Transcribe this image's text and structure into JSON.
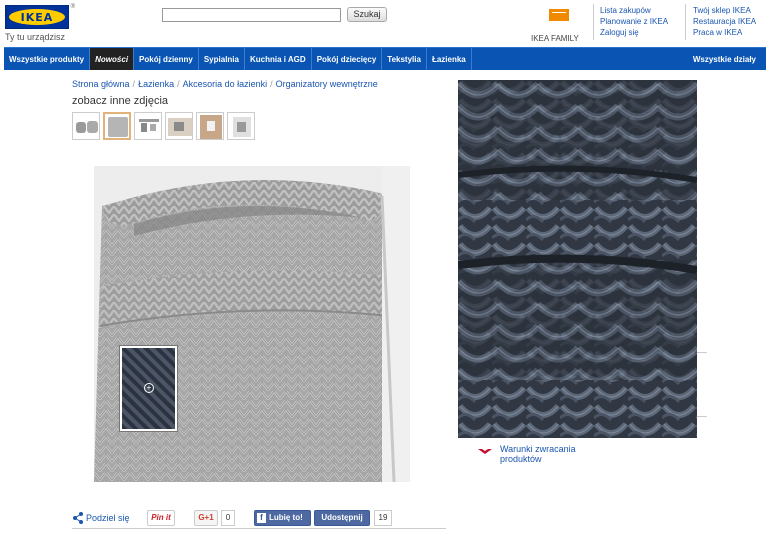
{
  "header": {
    "logo_text": "IKEA",
    "tagline": "Ty tu urządzisz",
    "search": {
      "value": "",
      "button_label": "Szukaj"
    },
    "family_label": "IKEA FAMILY",
    "links_col1": [
      "Lista zakupów",
      "Planowanie z IKEA",
      "Zaloguj się"
    ],
    "links_col2": [
      "Twój sklep IKEA",
      "Restauracja IKEA",
      "Praca w IKEA"
    ]
  },
  "nav": {
    "items": [
      "Wszystkie produkty",
      "Nowości",
      "Pokój dzienny",
      "Sypialnia",
      "Kuchnia i AGD",
      "Pokój dziecięcy",
      "Tekstylia",
      "Łazienka"
    ],
    "active": "Nowości",
    "all_departments": "Wszystkie działy"
  },
  "breadcrumb": [
    "Strona główna",
    "Łazienka",
    "Akcesoria do łazienki",
    "Organizatory wewnętrzne"
  ],
  "gallery": {
    "more_photos_label": "zobacz inne zdjęcia",
    "selected_thumb": 1,
    "thumb_count": 6
  },
  "returns_link": {
    "line1": "Warunki zwracania",
    "line2": "produktów"
  },
  "social": {
    "share_label": "Podziel się",
    "pinit_label": "Pin it",
    "gplus_label": "G+1",
    "gplus_count": "0",
    "fb_like_label": "Lubię to!",
    "fb_share_label": "Udostępnij",
    "fb_count": "19"
  },
  "colors": {
    "nav_blue": "#0a55b4",
    "active_tab": "#222222",
    "link_blue": "#1a56b0",
    "ikea_yellow": "#ffcc00",
    "ikea_blue": "#003399",
    "family_orange": "#f08a00"
  }
}
